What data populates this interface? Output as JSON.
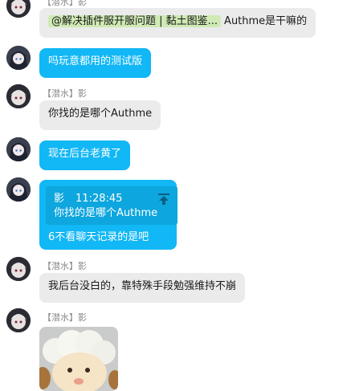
{
  "messages": [
    {
      "sender": "【潜水】影",
      "mention": "@解决插件服开服问题 | 黏土图鉴...",
      "text": "Authme是干嘛的"
    },
    {
      "text": "吗玩意都用的测试版"
    },
    {
      "sender": "【潜水】影",
      "text": "你找的是哪个Authme"
    },
    {
      "text": "现在后台老黄了"
    },
    {
      "quote": {
        "author": "影",
        "time": "11:28:45",
        "text": "你找的是哪个Authme"
      },
      "text": "6不看聊天记录的是吧"
    },
    {
      "sender": "【潜水】影",
      "text": "我后台没白的，靠特殊手段勉强维持不崩"
    },
    {
      "sender": "【潜水】影",
      "sticker": "sheep-sticker"
    }
  ],
  "colors": {
    "self_bubble": "#12b7f5",
    "other_bubble": "#ebebeb",
    "quote_box": "#0ea6de",
    "mention_bg": "#cfeab4",
    "sender_name": "#8a8a8a"
  },
  "icons": [
    "avatar-other",
    "avatar-self",
    "jump-to-quote-icon",
    "sheep-sticker"
  ]
}
